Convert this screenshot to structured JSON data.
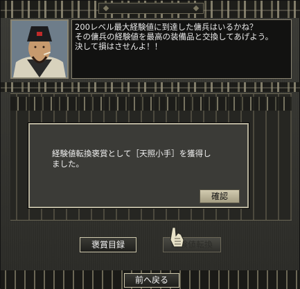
{
  "npc_dialog": {
    "line1": "200レベル最大経験値に到達した傭兵はいるかね？",
    "line2": "その傭兵の経験値を最高の装備品と交換してあげよう。",
    "line3": "決して損はさせんよ！！"
  },
  "modal": {
    "message_line1": "経験値転換褒賞として［天照小手］を獲得し",
    "message_line2": "ました。",
    "confirm_label": "確認"
  },
  "actions": {
    "reward_list_label": "褒賞目録",
    "exp_convert_label": "経験値転換"
  },
  "navigation": {
    "back_label": "前へ戻る"
  }
}
